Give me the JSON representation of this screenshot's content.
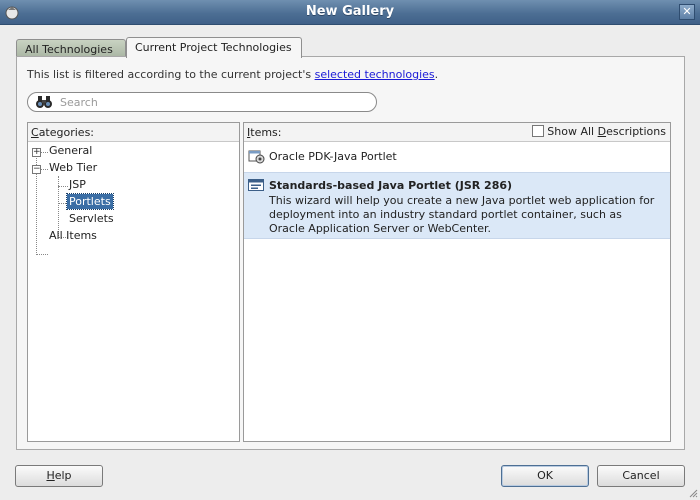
{
  "window": {
    "title": "New Gallery"
  },
  "tabs": [
    {
      "label": "All Technologies",
      "active": false
    },
    {
      "label": "Current Project Technologies",
      "active": true
    }
  ],
  "filter_note": {
    "text": "This list is filtered according to the current project's ",
    "link": "selected technologies",
    "suffix": "."
  },
  "search": {
    "placeholder": "Search",
    "value": ""
  },
  "categories": {
    "header_accel": "C",
    "header_rest": "ategories:",
    "items": [
      {
        "label": "General",
        "expander": "+"
      },
      {
        "label": "Web Tier",
        "expander": "−"
      },
      {
        "label": "JSP"
      },
      {
        "label": "Portlets",
        "selected": true
      },
      {
        "label": "Servlets"
      },
      {
        "label": "All Items"
      }
    ]
  },
  "items": {
    "header_accel": "I",
    "header_rest": "tems:",
    "show_all_pre": "Show All ",
    "show_all_accel": "D",
    "show_all_rest": "escriptions",
    "show_all_checked": false,
    "list": [
      {
        "title": "Oracle PDK-Java Portlet",
        "icon": "portlet-gear-icon"
      },
      {
        "title": "Standards-based Java Portlet (JSR 286)",
        "icon": "portlet-window-icon",
        "selected": true,
        "description": "This wizard will help you create a new Java portlet web application for deployment into an industry standard portlet container, such as Oracle Application Server or WebCenter."
      }
    ]
  },
  "buttons": {
    "help_accel": "H",
    "help_rest": "elp",
    "ok": "OK",
    "cancel": "Cancel"
  },
  "colors": {
    "titlebar": "#4d6f94",
    "selection": "#3b6ea5",
    "item_highlight": "#dbe8f7",
    "link": "#1a1ad6"
  }
}
